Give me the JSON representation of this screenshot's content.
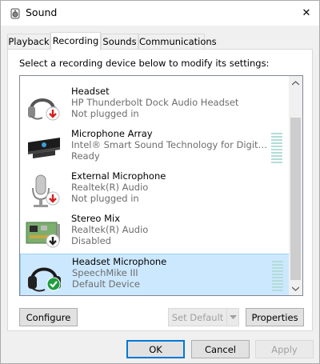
{
  "window": {
    "title": "Sound",
    "close_glyph": "✕"
  },
  "tabs": [
    {
      "label": "Playback",
      "active": false
    },
    {
      "label": "Recording",
      "active": true
    },
    {
      "label": "Sounds",
      "active": false
    },
    {
      "label": "Communications",
      "active": false
    }
  ],
  "panel": {
    "instruction": "Select a recording device below to modify its settings:"
  },
  "devices": [
    {
      "name": "Headset",
      "description": "HP Thunderbolt Dock Audio Headset",
      "status": "Not plugged in",
      "icon": "headset-icon",
      "badge": "red-down-arrow-badge",
      "selected": false,
      "meter": false
    },
    {
      "name": "Microphone Array",
      "description": "Intel® Smart Sound Technology for Digital Mi...",
      "status": "Ready",
      "icon": "microphone-array-icon",
      "badge": "",
      "selected": false,
      "meter": true
    },
    {
      "name": "External Microphone",
      "description": "Realtek(R) Audio",
      "status": "Not plugged in",
      "icon": "external-microphone-icon",
      "badge": "red-down-arrow-badge",
      "selected": false,
      "meter": false
    },
    {
      "name": "Stereo Mix",
      "description": "Realtek(R) Audio",
      "status": "Disabled",
      "icon": "sound-card-icon",
      "badge": "black-down-arrow-badge",
      "selected": false,
      "meter": false
    },
    {
      "name": "Headset Microphone",
      "description": "SpeechMike III",
      "status": "Default Device",
      "icon": "headset-icon",
      "badge": "green-check-badge",
      "selected": true,
      "meter": true
    }
  ],
  "buttons": {
    "configure": "Configure",
    "set_default": "Set Default",
    "properties": "Properties",
    "ok": "OK",
    "cancel": "Cancel",
    "apply": "Apply"
  },
  "colors": {
    "selection_bg": "#cce8ff",
    "selection_border": "#99d1ff",
    "default_button_border": "#0078d7",
    "meter": "#b3ddd8",
    "status_red": "#d42020",
    "status_green": "#1e9e3e"
  }
}
